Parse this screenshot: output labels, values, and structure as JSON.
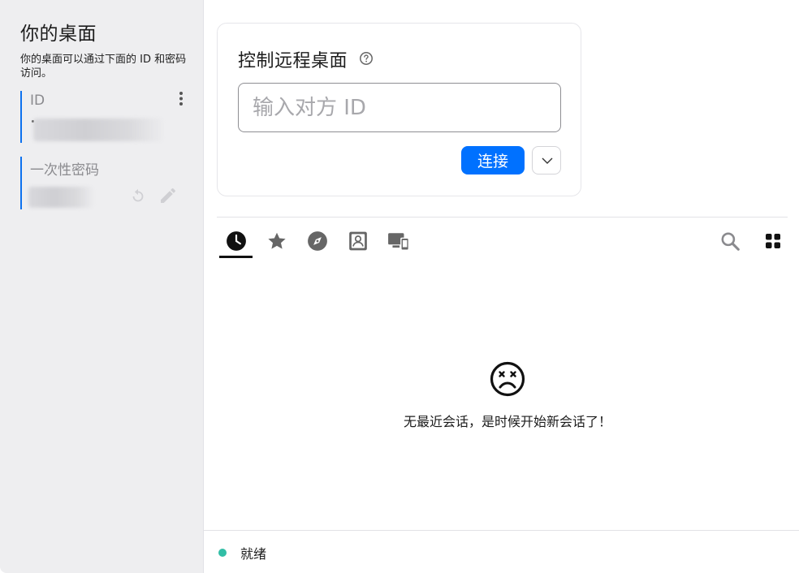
{
  "sidebar": {
    "title": "你的桌面",
    "description": "你的桌面可以通过下面的 ID 和密码访问。",
    "id_label": "ID",
    "password_label": "一次性密码"
  },
  "connect": {
    "title": "控制远程桌面",
    "input_placeholder": "输入对方 ID",
    "connect_label": "连接"
  },
  "tabs": [
    {
      "icon": "clock-icon",
      "name": "recent",
      "active": true
    },
    {
      "icon": "star-icon",
      "name": "favorites",
      "active": false
    },
    {
      "icon": "compass-icon",
      "name": "discovered",
      "active": false
    },
    {
      "icon": "address-book-icon",
      "name": "address-book",
      "active": false
    },
    {
      "icon": "devices-icon",
      "name": "accessible-devices",
      "active": false
    }
  ],
  "empty_state": {
    "message": "无最近会话，是时候开始新会话了！"
  },
  "status": {
    "text": "就绪",
    "color": "#32bea6"
  },
  "colors": {
    "accent": "#0071ff",
    "sidebar_bg": "#eeeef0"
  }
}
